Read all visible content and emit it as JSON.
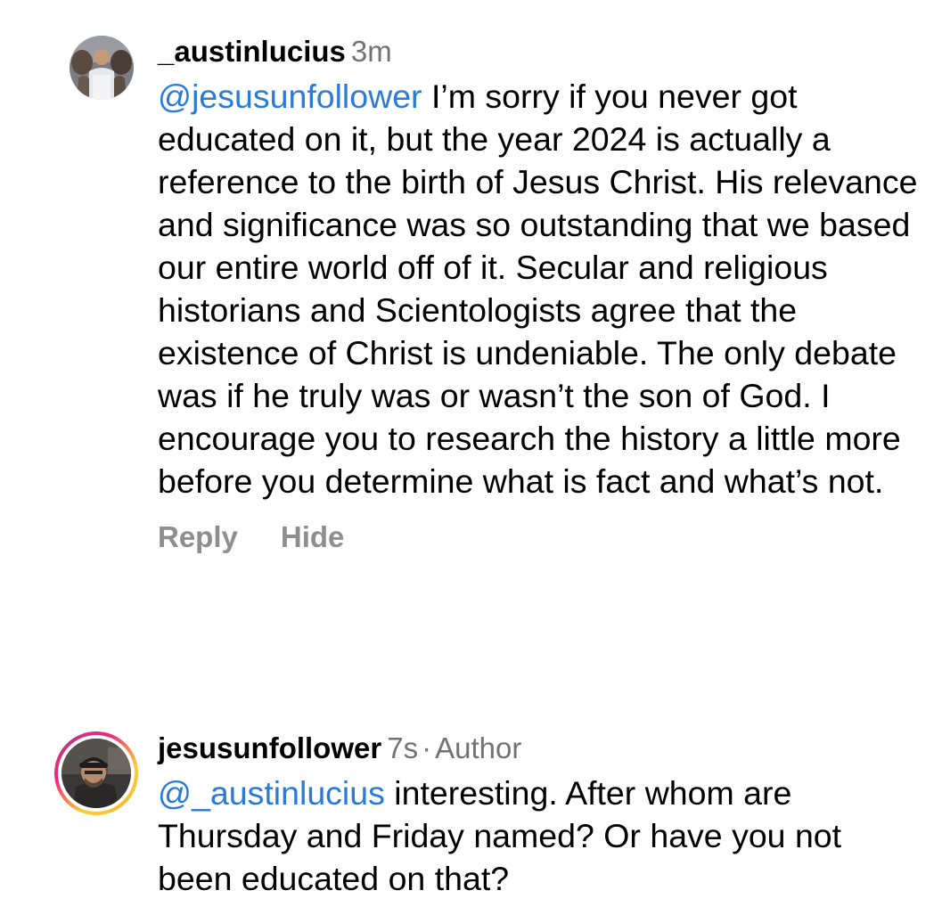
{
  "comments": [
    {
      "username": "_austinlucius",
      "time": "3m",
      "mention": "@jesusunfollower",
      "text": "I’m sorry if you never got educated on it, but the year 2024 is actually a reference to the birth of Jesus Christ. His relevance and significance was so outstanding that we based our entire world off of it. Secular and religious historians and Scientologists agree that the existence of Christ is undeniable. The only debate was if he truly was or wasn’t the son of God. I encourage you to research the history a little more before you determine what is fact and what’s not.",
      "actions": {
        "reply": "Reply",
        "hide": "Hide"
      }
    },
    {
      "username": "jesusunfollower",
      "time": "7s",
      "separator": "·",
      "badge": "Author",
      "mention": "@_austinlucius",
      "text": "interesting. After whom are Thursday and Friday named? Or have you not been educated on that?"
    }
  ],
  "colors": {
    "mention": "#2b7bd6",
    "muted": "#737373",
    "action": "#8e8e8e",
    "story_ring": [
      "#f9ce34",
      "#ee2a7b",
      "#c13584"
    ]
  }
}
